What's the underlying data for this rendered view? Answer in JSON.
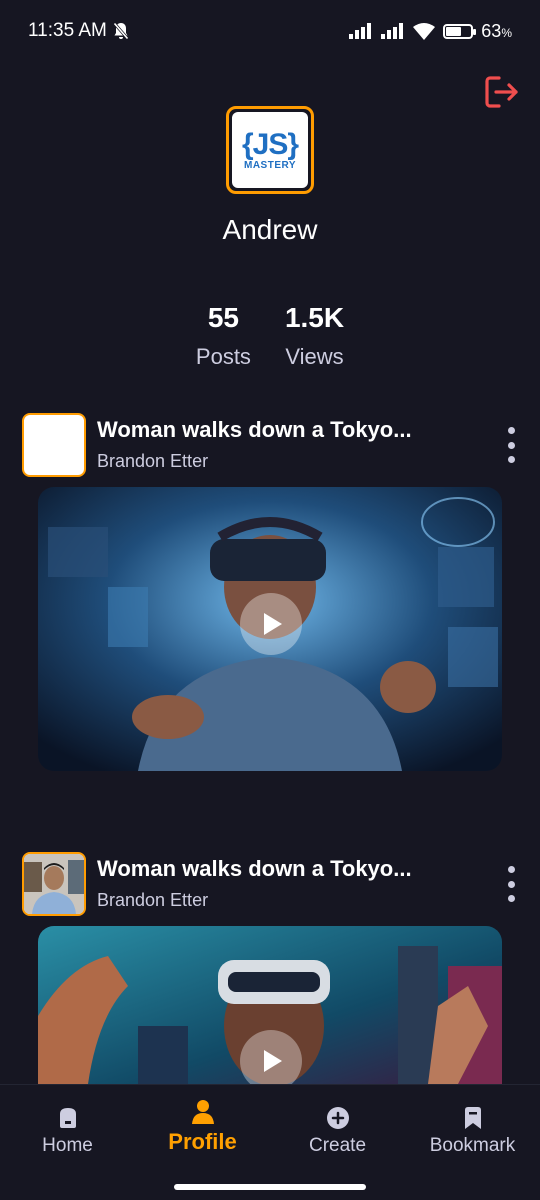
{
  "status_bar": {
    "time": "11:35 AM",
    "battery_pct": "63",
    "battery_level": 0.63
  },
  "profile": {
    "username": "Andrew",
    "avatar_logo_text": "JS MASTERY"
  },
  "stats": [
    {
      "value": "55",
      "label": "Posts"
    },
    {
      "value": "1.5K",
      "label": "Views"
    }
  ],
  "posts": [
    {
      "title": "Woman walks down a Tokyo...",
      "author": "Brandon Etter"
    },
    {
      "title": "Woman walks down a Tokyo...",
      "author": "Brandon Etter"
    }
  ],
  "tabs": [
    {
      "label": "Home",
      "icon": "home-icon"
    },
    {
      "label": "Profile",
      "icon": "profile-icon",
      "active": true
    },
    {
      "label": "Create",
      "icon": "plus-circle-icon"
    },
    {
      "label": "Bookmark",
      "icon": "bookmark-icon"
    }
  ],
  "colors": {
    "background": "#161622",
    "accent": "#FF9C01",
    "muted_text": "#CDCDE0",
    "logout": "#F04E4E"
  }
}
